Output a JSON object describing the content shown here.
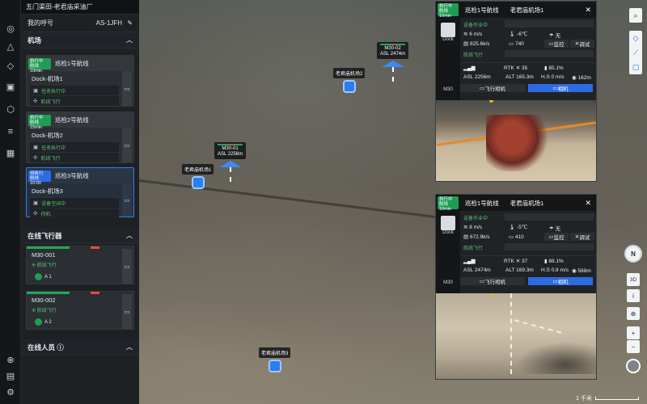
{
  "app": {
    "title": "五门渠田-老君庙采油厂"
  },
  "callsign": {
    "label": "我的呼号",
    "value": "AS-1JFH",
    "edit_icon": "pencil-icon"
  },
  "sections": {
    "dock": "机场",
    "drones": "在线飞行器",
    "people": "在线人员"
  },
  "rail_icons": [
    "drone-icon",
    "map-icon",
    "layers-icon",
    "media-icon",
    "box-icon",
    "list-icon",
    "calendar-icon",
    "globe-icon",
    "report-icon",
    "settings-icon"
  ],
  "dock_cards": [
    {
      "badge": "执行中",
      "badge_sub": "航线 10min",
      "route": "巡检1号航线",
      "dock": "Dock-机场1",
      "status1": "任务执行中",
      "status2": "航线飞行"
    },
    {
      "badge": "执行中",
      "badge_sub": "航线 15min",
      "route": "巡检2号航线",
      "dock": "Dock-机场2",
      "status1": "任务执行中",
      "status2": "航线飞行"
    },
    {
      "badge": "待执行",
      "badge_sub": "航线 10:00",
      "route": "巡检3号航线",
      "dock": "Dock-机场3",
      "status1": "设备空闲中",
      "status2": "待机"
    }
  ],
  "drones": [
    {
      "name": "M30-001",
      "status": "航线飞行",
      "user": "A 1"
    },
    {
      "name": "M30-002",
      "status": "航线飞行",
      "user": "A 2"
    }
  ],
  "map": {
    "markers": [
      {
        "label": "老君庙机场1"
      },
      {
        "label": "老君庙机场2"
      },
      {
        "label": "老君庙机场3"
      }
    ],
    "aircraft": [
      {
        "name": "M30-01",
        "asl": "ASL 2256m"
      },
      {
        "name": "M30-02",
        "asl": "ASL 2474m"
      }
    ],
    "tools": [
      "search-icon",
      "polygon-icon",
      "line-icon",
      "square-icon"
    ],
    "controls": {
      "view3d": "3D",
      "info": "i",
      "locate": "⊕",
      "zoom_in": "+",
      "zoom_out": "−",
      "compass": "N"
    },
    "scale": "1 千米"
  },
  "live_cards": [
    {
      "badge": "执行中",
      "badge_sub": "航线10min",
      "route": "巡检1号航线",
      "dock": "老君庙机场1",
      "dock_label": "Dock",
      "drone_label": "M30",
      "dock_status": "设备作业中",
      "wind": "6 m/s",
      "temp": "-6℃",
      "rain": "无",
      "storage": "825.6k/s",
      "count": "740",
      "monitor": "监控",
      "debug": "调试",
      "drone_status": "航线飞行",
      "rtk": "35",
      "battery": "85.1%",
      "asl": "ASL 2256m",
      "alt": "ALT 165.3m",
      "hspeed": "H.S 0 m/s",
      "dist": "162m",
      "btn_fly": "飞行相机",
      "btn_cam": "相机"
    },
    {
      "badge": "执行中",
      "badge_sub": "航线10min",
      "route": "巡检1号航线",
      "dock": "老君庙机场1",
      "dock_label": "Dock",
      "drone_label": "M30",
      "dock_status": "设备作业中",
      "wind": "8 m/s",
      "temp": "-5℃",
      "rain": "无",
      "storage": "672.9k/s",
      "count": "410",
      "monitor": "监控",
      "debug": "调试",
      "drone_status": "航线飞行",
      "rtk": "37",
      "battery": "88.1%",
      "asl": "ASL 2474m",
      "alt": "ALT 169.3m",
      "hspeed": "H.S 0.8 m/s",
      "dist": "568m",
      "btn_fly": "飞行相机",
      "btn_cam": "相机"
    }
  ]
}
